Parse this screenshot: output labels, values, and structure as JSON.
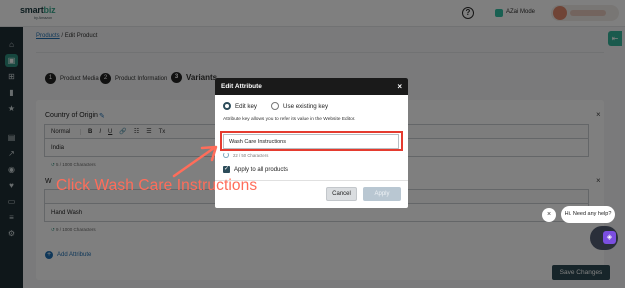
{
  "app": {
    "logo_main": "smart",
    "logo_accent": "biz",
    "logo_sub": "by Amazon",
    "help_label": "?",
    "azai_label": "AZai Mode"
  },
  "sidebar": {
    "items": [
      {
        "icon": "home-icon",
        "glyph": "⌂"
      },
      {
        "icon": "box-icon",
        "glyph": "▣"
      },
      {
        "icon": "cart-icon",
        "glyph": "⊞"
      },
      {
        "icon": "chart-icon",
        "glyph": "▮"
      },
      {
        "icon": "star-icon",
        "glyph": "★"
      },
      {
        "icon": "grid-icon",
        "glyph": "▤"
      },
      {
        "icon": "trend-icon",
        "glyph": "↗"
      },
      {
        "icon": "bag-icon",
        "glyph": "◉"
      },
      {
        "icon": "tag-icon",
        "glyph": "♥"
      },
      {
        "icon": "chat-icon",
        "glyph": "▭"
      },
      {
        "icon": "layers-icon",
        "glyph": "≡"
      },
      {
        "icon": "settings-icon",
        "glyph": "⚙"
      }
    ]
  },
  "breadcrumb": {
    "parent": "Products",
    "separator": " / ",
    "current": "Edit Product"
  },
  "steps": [
    {
      "num": "1",
      "label": "Product Media"
    },
    {
      "num": "2",
      "label": "Product Information"
    },
    {
      "num": "3",
      "label": "Variants"
    }
  ],
  "attribute1": {
    "label": "Country of Origin",
    "value": "India",
    "count": "5 / 1000 Characters"
  },
  "attribute2": {
    "label": "W",
    "value": "Hand Wash",
    "count": "9 / 1000 Characters"
  },
  "toolbar": {
    "format_label": "Normal",
    "bold": "B",
    "italic": "I",
    "underline": "U",
    "link": "🔗",
    "list_ordered": "☷",
    "list_bullet": "☰",
    "clear": "Tx"
  },
  "add_attribute_label": "Add Attribute",
  "save_label": "Save Changes",
  "modal": {
    "title": "Edit Attribute",
    "close": "×",
    "radio_edit": "Edit key",
    "radio_existing": "Use existing key",
    "description": "Attribute key allows you to refer its value in the Website Editor.",
    "key_value": "Wash Care Instructions",
    "char_count": "22 / 50 Characters",
    "apply_all_label": "Apply to all products",
    "cancel_label": "Cancel",
    "apply_label": "Apply"
  },
  "callout": {
    "text": "Click Wash Care Instructions",
    "color": "#ff6d5a"
  },
  "chat": {
    "close": "×",
    "bubble": "Hi. Need any help?"
  },
  "colors": {
    "highlight": "#e53b2f",
    "sidebar": "#1f2f35",
    "accent": "#2f8f7e"
  }
}
